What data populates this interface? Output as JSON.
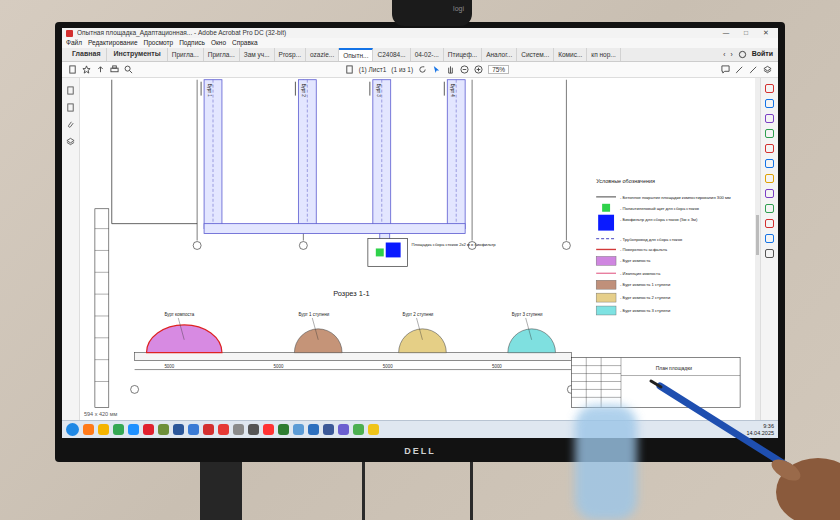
{
  "window": {
    "title": "Опытная площадка_Адаптационная... - Adobe Acrobat Pro DC (32-bit)",
    "controls": [
      "—",
      "□",
      "✕"
    ]
  },
  "menu": [
    "Файл",
    "Редактирование",
    "Просмотр",
    "Подпись",
    "Окно",
    "Справка"
  ],
  "tabs": [
    {
      "label": "Главная",
      "selected": false
    },
    {
      "label": "Инструменты",
      "selected": false
    },
    {
      "label": "Пригла...",
      "selected": false
    },
    {
      "label": "Пригла...",
      "selected": false
    },
    {
      "label": "Зам уч...",
      "selected": false
    },
    {
      "label": "Prosp...",
      "selected": false
    },
    {
      "label": "ozazie...",
      "selected": false
    },
    {
      "label": "Опытн...",
      "selected": true
    },
    {
      "label": "C24084...",
      "selected": false
    },
    {
      "label": "04-02-...",
      "selected": false
    },
    {
      "label": "Птицеф...",
      "selected": false
    },
    {
      "label": "Аналог...",
      "selected": false
    },
    {
      "label": "Систем...",
      "selected": false
    },
    {
      "label": "Комис...",
      "selected": false
    },
    {
      "label": "кп нор...",
      "selected": false
    }
  ],
  "tab_nav": [
    "‹",
    "›"
  ],
  "account": {
    "label": "Войти"
  },
  "toolbar": {
    "page": "(1) Лист1",
    "page_count": "(1 из 1)",
    "zoom": "75%"
  },
  "drawing": {
    "pipes": [
      {
        "label": "Бурт 1"
      },
      {
        "label": "Бурт 2"
      },
      {
        "label": "Бурт 3"
      },
      {
        "label": "Бурт 4"
      }
    ],
    "box_label": "Площадка сбора стоков 2х2 м в биофильтр",
    "section_title": "Розрез 1-1",
    "mounds": [
      {
        "label": "Бурт компоста",
        "color": "#d78ae2"
      },
      {
        "label": "Бурт 1 ступени",
        "color": "#c59478"
      },
      {
        "label": "Бурт 2 ступени",
        "color": "#e5cf86"
      },
      {
        "label": "Бурт 3 ступени",
        "color": "#7fe0e0"
      }
    ],
    "dims": [
      "5000",
      "5000",
      "5000",
      "5000"
    ],
    "legend_title": "Условные обозначения",
    "legend": [
      {
        "kind": "line",
        "color": "#7a7a7a",
        "label": "- Бетонное покрытие площадки компостирования 300 мм"
      },
      {
        "kind": "square",
        "color": "#2fd24a",
        "label": "- Полиэтиленовый щит для сбора стоков"
      },
      {
        "kind": "block",
        "color": "#0a1aff",
        "label": "- Биофильтр для сбора стоков (5м х 3м)"
      },
      {
        "kind": "dashed",
        "color": "#6a6acc",
        "label": "- Трубопровод для сбора стоков"
      },
      {
        "kind": "line",
        "color": "#d23a3a",
        "label": "- Поверхность асфальта"
      },
      {
        "kind": "fill",
        "color": "#cf86e0",
        "label": "- Бурт компоста"
      },
      {
        "kind": "line",
        "color": "#e87fa0",
        "label": "- Изоляция компоста"
      },
      {
        "kind": "fill",
        "color": "#c0907a",
        "label": "- Бурт компоста 1 ступени"
      },
      {
        "kind": "fill",
        "color": "#e6cf8a",
        "label": "- Бурт компоста 2 ступени"
      },
      {
        "kind": "fill",
        "color": "#7ee2e2",
        "label": "- Бурт компоста 3 ступени"
      }
    ],
    "stamp_title": "План площадки"
  },
  "status": {
    "page_size": "594 x 420 мм"
  },
  "taskbar": {
    "apps": [
      {
        "color": "#1e88e5"
      },
      {
        "color": "#ff7a1a"
      },
      {
        "color": "#f4b400"
      },
      {
        "color": "#34a853"
      },
      {
        "color": "#1e90ff"
      },
      {
        "color": "#e0202e"
      },
      {
        "color": "#6d8f3a"
      },
      {
        "color": "#2b579a"
      },
      {
        "color": "#3a7bd5"
      },
      {
        "color": "#d32f2f"
      },
      {
        "color": "#e53935"
      },
      {
        "color": "#8a8a8a"
      },
      {
        "color": "#555555"
      },
      {
        "color": "#ff3333"
      },
      {
        "color": "#2e7d32"
      },
      {
        "color": "#5b9bd5"
      },
      {
        "color": "#2c6fbe"
      },
      {
        "color": "#3b5998"
      },
      {
        "color": "#6b5fd0"
      },
      {
        "color": "#4caf50"
      },
      {
        "color": "#f0c419"
      }
    ],
    "time": "9:36",
    "date": "14.04.2025"
  },
  "monitor": {
    "brand": "DELL"
  },
  "webcam": {
    "brand": "logi"
  }
}
